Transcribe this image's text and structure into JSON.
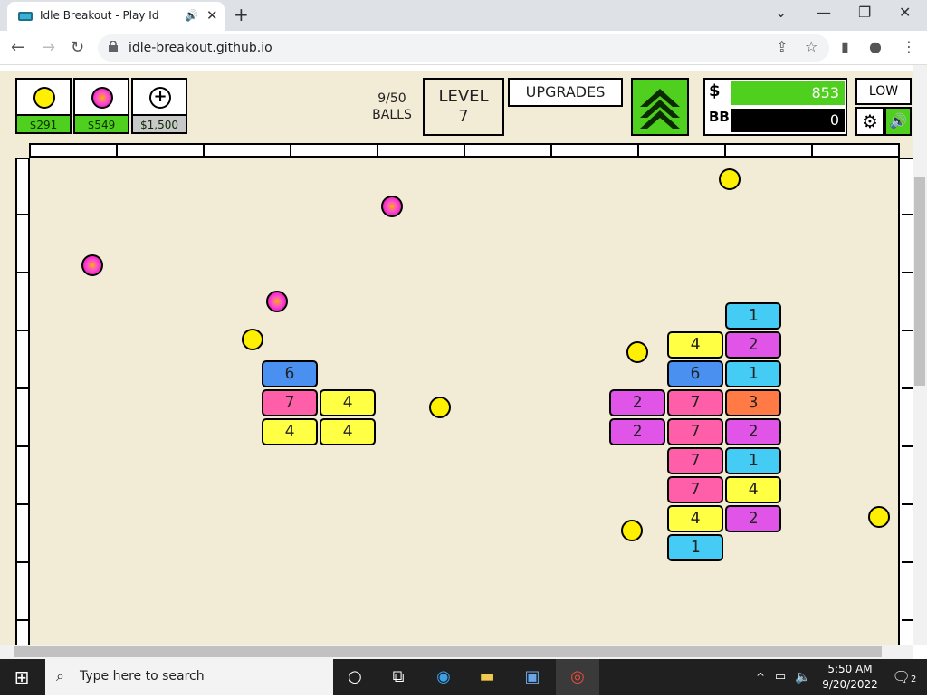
{
  "browser": {
    "tab_title": "Idle Breakout - Play Idle Brea",
    "url": "idle-breakout.github.io",
    "new_tab": "+",
    "close_tab": "✕",
    "audio_icon": "🔊"
  },
  "game": {
    "shop": [
      {
        "type": "basic",
        "price": "$291"
      },
      {
        "type": "plasma",
        "price": "$549"
      },
      {
        "type": "add",
        "price": "$1,500"
      }
    ],
    "balls_count": "9/50",
    "balls_label": "BALLS",
    "level_label": "LEVEL",
    "level": "7",
    "upgrades_label": "UPGRADES",
    "money_symbol": "$",
    "money": "853",
    "bb_symbol": "BB",
    "bb": "0",
    "quality_label": "LOW",
    "bricks": [
      {
        "value": "6",
        "color": "#4a90f0"
      },
      {
        "value": "7",
        "color": "#ff5fa8"
      },
      {
        "value": "4",
        "color": "#ffff44"
      },
      {
        "value": "4",
        "color": "#ffff44"
      },
      {
        "value": "4",
        "color": "#ffff44"
      },
      {
        "value": "1",
        "color": "#44ccf4"
      },
      {
        "value": "4",
        "color": "#ffff44"
      },
      {
        "value": "2",
        "color": "#e055e8"
      },
      {
        "value": "6",
        "color": "#4a90f0"
      },
      {
        "value": "1",
        "color": "#44ccf4"
      },
      {
        "value": "2",
        "color": "#e055e8"
      },
      {
        "value": "7",
        "color": "#ff5fa8"
      },
      {
        "value": "3",
        "color": "#ff7a44"
      },
      {
        "value": "2",
        "color": "#e055e8"
      },
      {
        "value": "7",
        "color": "#ff5fa8"
      },
      {
        "value": "2",
        "color": "#e055e8"
      },
      {
        "value": "7",
        "color": "#ff5fa8"
      },
      {
        "value": "1",
        "color": "#44ccf4"
      },
      {
        "value": "7",
        "color": "#ff5fa8"
      },
      {
        "value": "4",
        "color": "#ffff44"
      },
      {
        "value": "4",
        "color": "#ffff44"
      },
      {
        "value": "2",
        "color": "#e055e8"
      },
      {
        "value": "1",
        "color": "#44ccf4"
      }
    ]
  },
  "taskbar": {
    "search_placeholder": "Type here to search",
    "time": "5:50 AM",
    "date": "9/20/2022",
    "notifications": "2"
  }
}
